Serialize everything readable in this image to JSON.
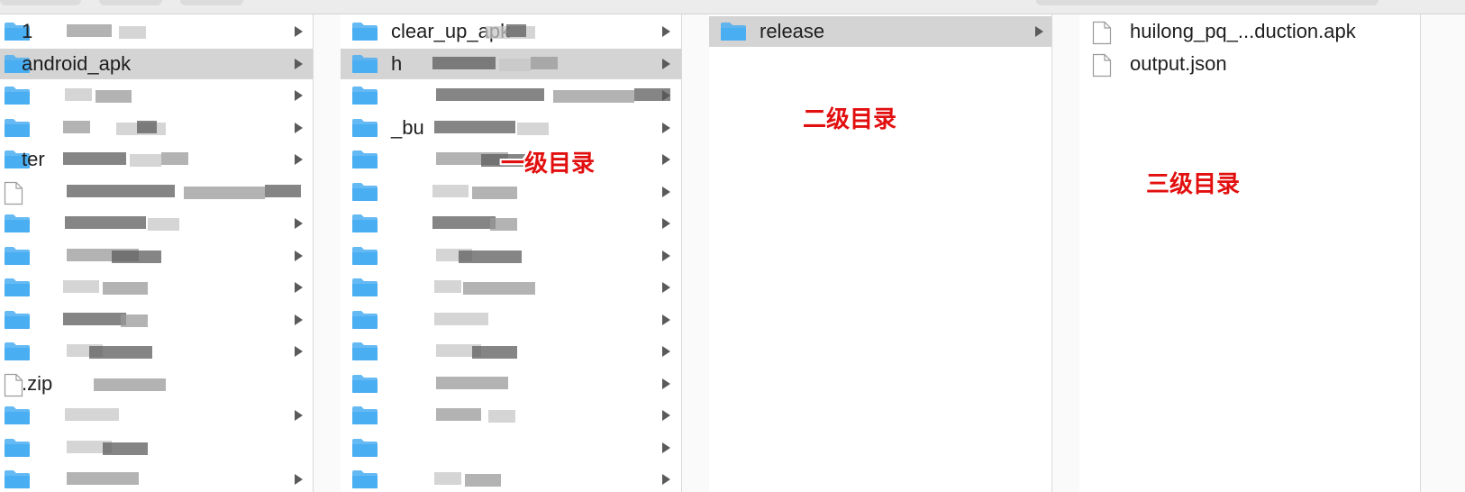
{
  "columns": {
    "level1": {
      "rows": [
        {
          "label": "1",
          "kind": "folder",
          "has_children": true
        },
        {
          "label": "android_apk",
          "kind": "folder",
          "has_children": true,
          "selected": true
        },
        {
          "label": "",
          "kind": "folder",
          "has_children": true
        },
        {
          "label": "",
          "kind": "folder",
          "has_children": true
        },
        {
          "label": "ter",
          "kind": "folder",
          "has_children": true
        },
        {
          "label": "",
          "kind": "file",
          "has_children": false
        },
        {
          "label": "",
          "kind": "folder",
          "has_children": true
        },
        {
          "label": "",
          "kind": "folder",
          "has_children": true
        },
        {
          "label": "",
          "kind": "folder",
          "has_children": true
        },
        {
          "label": "",
          "kind": "folder",
          "has_children": true
        },
        {
          "label": "",
          "kind": "folder",
          "has_children": true
        },
        {
          "label": ".zip",
          "kind": "file",
          "has_children": false
        },
        {
          "label": "",
          "kind": "folder",
          "has_children": true
        },
        {
          "label": "",
          "kind": "folder",
          "has_children": false
        },
        {
          "label": "",
          "kind": "folder",
          "has_children": true
        }
      ]
    },
    "level2": {
      "rows": [
        {
          "label": "clear_up_apk",
          "kind": "folder",
          "has_children": true
        },
        {
          "label": "h",
          "kind": "folder",
          "has_children": true,
          "selected": true
        },
        {
          "label": "",
          "kind": "folder",
          "has_children": true
        },
        {
          "label": "_bu",
          "kind": "folder",
          "has_children": true
        },
        {
          "label": "",
          "kind": "folder",
          "has_children": true
        },
        {
          "label": "",
          "kind": "folder",
          "has_children": true
        },
        {
          "label": "",
          "kind": "folder",
          "has_children": true
        },
        {
          "label": "",
          "kind": "folder",
          "has_children": true
        },
        {
          "label": "",
          "kind": "folder",
          "has_children": true
        },
        {
          "label": "",
          "kind": "folder",
          "has_children": true
        },
        {
          "label": "",
          "kind": "folder",
          "has_children": true
        },
        {
          "label": "",
          "kind": "folder",
          "has_children": true
        },
        {
          "label": "",
          "kind": "folder",
          "has_children": true
        },
        {
          "label": "",
          "kind": "folder",
          "has_children": true
        },
        {
          "label": "",
          "kind": "folder",
          "has_children": true
        }
      ]
    },
    "level3": {
      "rows": [
        {
          "label": "release",
          "kind": "folder",
          "has_children": true,
          "selected": true
        }
      ]
    },
    "level4": {
      "rows": [
        {
          "label": "huilong_pq_...duction.apk",
          "kind": "file",
          "has_children": false
        },
        {
          "label": "output.json",
          "kind": "file",
          "has_children": false
        }
      ]
    }
  },
  "annotations": {
    "first_level": "一级目录",
    "second_level": "二级目录",
    "third_level": "三级目录"
  },
  "colors": {
    "folder": "#4aaef2",
    "selection": "#d4d4d4",
    "annotation": "#e20f0f"
  }
}
